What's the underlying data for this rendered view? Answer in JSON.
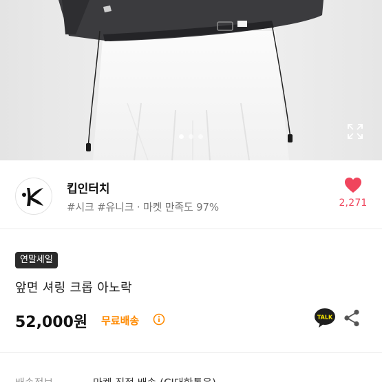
{
  "shop": {
    "name": "킵인터치",
    "tags": "#시크 #유니크 · 마켓 만족도 97%",
    "like_count": "2,271",
    "like_color": "#f0455d"
  },
  "product": {
    "badge": "연말세일",
    "title": "앞면 셔링 크롭 아노락",
    "price": "52,000원",
    "shipping_badge": "무료배송",
    "shipping_color": "#ff8a00"
  },
  "carousel": {
    "slide_count": 3,
    "active_slide": 1
  },
  "delivery": {
    "label": "배송정보",
    "value": "마켓 직접 배송 (CJ대한통운)"
  },
  "icons": [
    "expand-icon",
    "heart-icon",
    "kakaotalk-icon",
    "share-icon",
    "info-icon"
  ]
}
